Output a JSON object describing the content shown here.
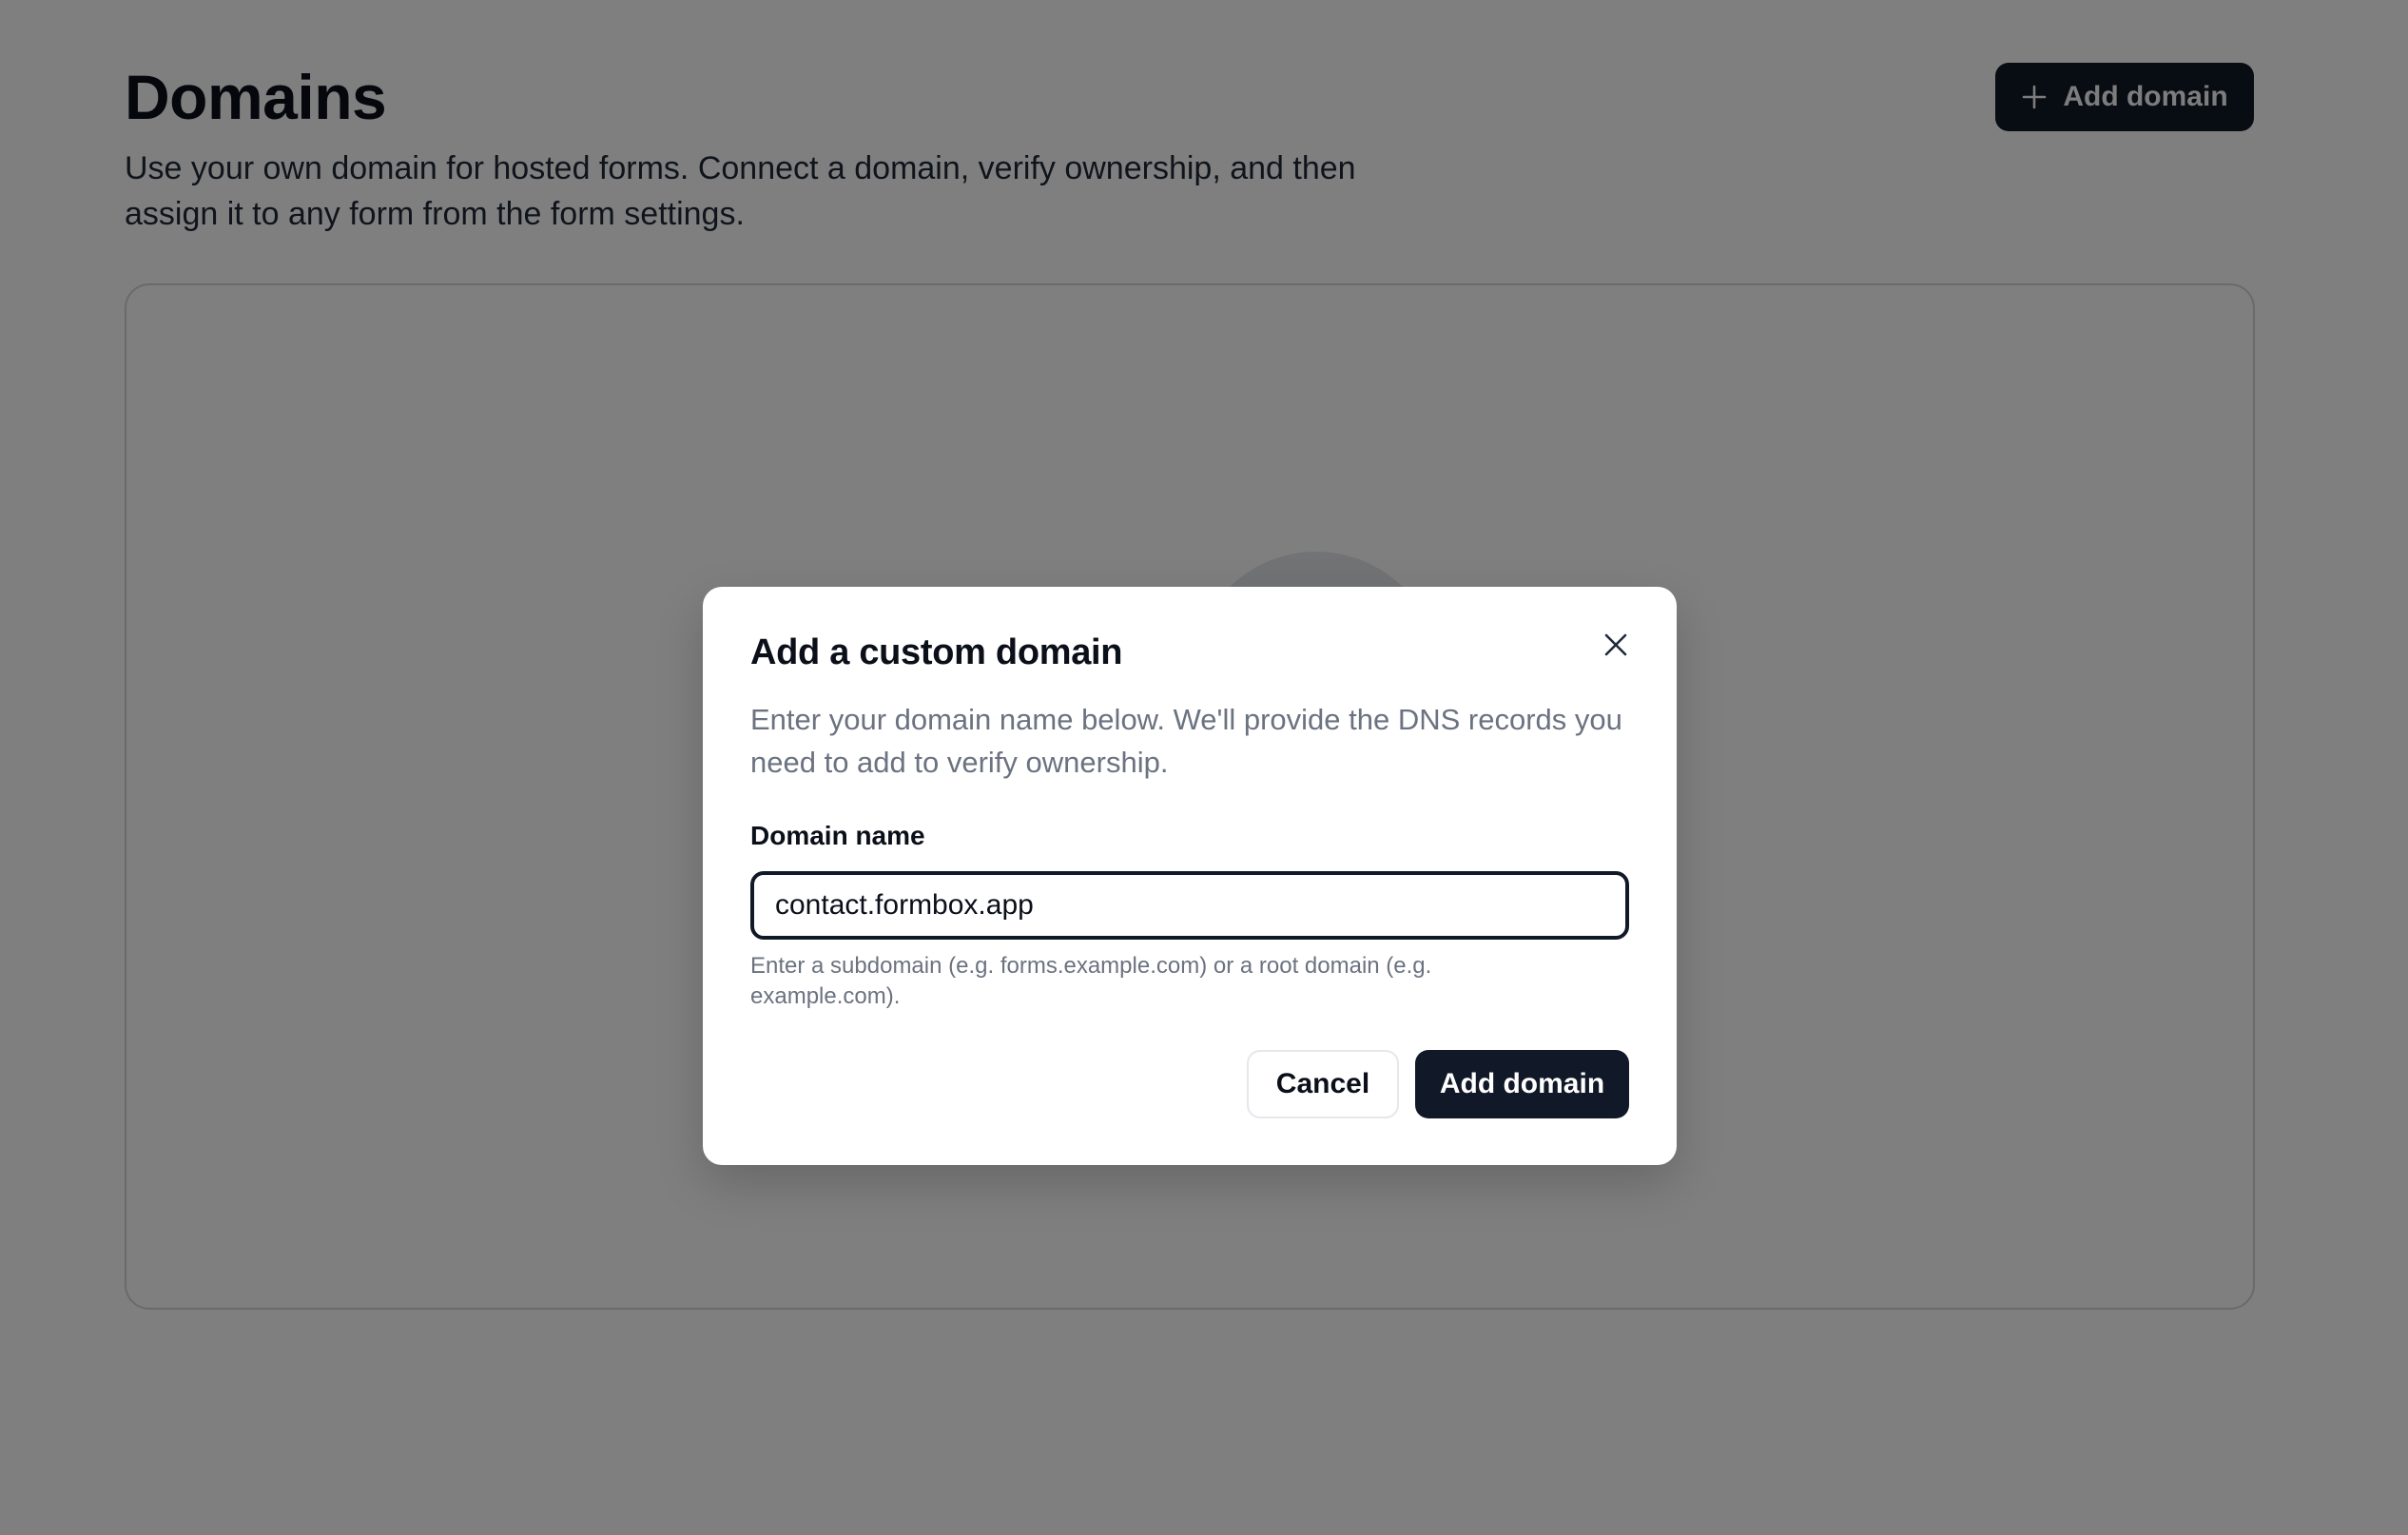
{
  "page": {
    "title": "Domains",
    "description": "Use your own domain for hosted forms. Connect a domain, verify ownership, and then assign it to any form from the form settings.",
    "add_button_label": "Add domain",
    "add_button_icon": "plus-icon"
  },
  "dialog": {
    "title": "Add a custom domain",
    "close_icon": "close-icon",
    "description": "Enter your domain name below. We'll provide the DNS records you need to add to verify ownership.",
    "field_label": "Domain name",
    "input_value": "contact.formbox.app",
    "helper_text": "Enter a subdomain (e.g. forms.example.com) or a root domain (e.g. example.com).",
    "cancel_label": "Cancel",
    "submit_label": "Add domain"
  },
  "colors": {
    "primary": "#111827",
    "overlay": "rgba(0,0,0,0.5)",
    "muted_text": "#6b7280"
  }
}
